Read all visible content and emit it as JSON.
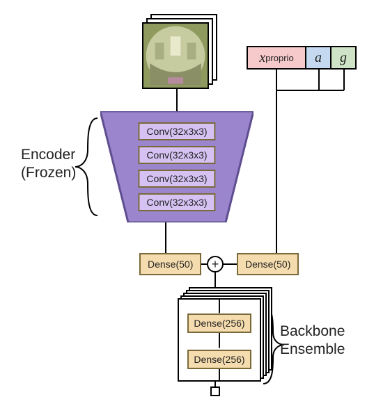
{
  "labels": {
    "encoder_line1": "Encoder",
    "encoder_line2": "(Frozen)",
    "backbone_line1": "Backbone",
    "backbone_line2": "Ensemble"
  },
  "encoder": {
    "conv": [
      "Conv(32x3x3)",
      "Conv(32x3x3)",
      "Conv(32x3x3)",
      "Conv(32x3x3)"
    ]
  },
  "dense_left": "Dense(50)",
  "dense_right": "Dense(50)",
  "inputs": {
    "x_var": "x",
    "x_sub": "proprio",
    "a": "a",
    "g": "g"
  },
  "backbone": {
    "layers": [
      "Dense(256)",
      "Dense(256)"
    ]
  },
  "plus": "+",
  "chart_data": {
    "type": "diagram",
    "title": "Neural network architecture diagram",
    "components": [
      {
        "name": "Image stack input",
        "kind": "input-image"
      },
      {
        "name": "Encoder (Frozen)",
        "kind": "encoder",
        "layers": [
          "Conv(32x3x3)",
          "Conv(32x3x3)",
          "Conv(32x3x3)",
          "Conv(32x3x3)"
        ]
      },
      {
        "name": "Dense(50) image branch",
        "kind": "dense",
        "units": 50
      },
      {
        "name": "x_proprio",
        "kind": "input-vector"
      },
      {
        "name": "a",
        "kind": "input-vector"
      },
      {
        "name": "g",
        "kind": "input-vector"
      },
      {
        "name": "Dense(50) vector branch",
        "kind": "dense",
        "units": 50
      },
      {
        "name": "Add",
        "kind": "merge-add"
      },
      {
        "name": "Backbone Ensemble",
        "kind": "ensemble",
        "layers": [
          "Dense(256)",
          "Dense(256)"
        ]
      },
      {
        "name": "Output",
        "kind": "output-scalar"
      }
    ],
    "edges": [
      [
        "Image stack input",
        "Encoder (Frozen)"
      ],
      [
        "Encoder (Frozen)",
        "Dense(50) image branch"
      ],
      [
        "x_proprio",
        "Dense(50) vector branch"
      ],
      [
        "a",
        "Dense(50) vector branch"
      ],
      [
        "g",
        "Dense(50) vector branch"
      ],
      [
        "Dense(50) image branch",
        "Add"
      ],
      [
        "Dense(50) vector branch",
        "Add"
      ],
      [
        "Add",
        "Backbone Ensemble"
      ],
      [
        "Backbone Ensemble",
        "Output"
      ]
    ]
  }
}
